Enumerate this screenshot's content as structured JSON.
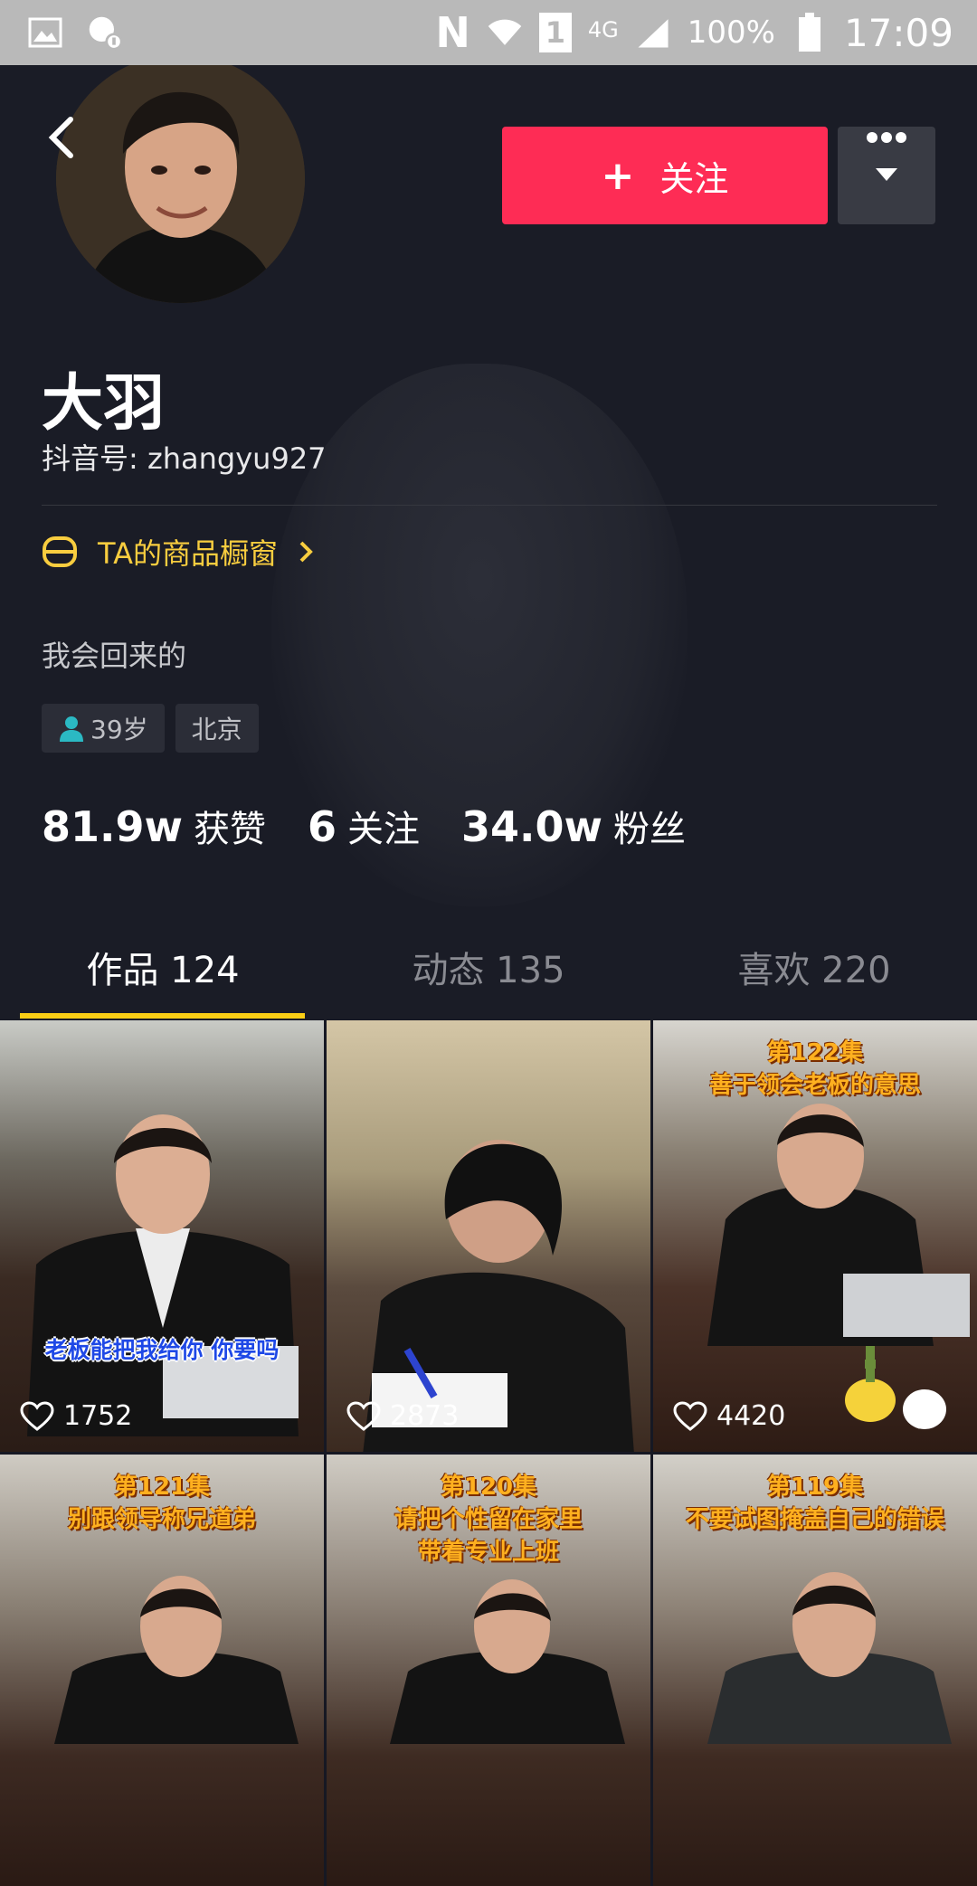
{
  "status_bar": {
    "network_letter": "N",
    "sim_slot": "1",
    "network_type": "4G",
    "battery_percent": "100%",
    "time": "17:09",
    "icons": [
      "image-icon",
      "messenger-icon",
      "nfc-icon",
      "wifi-icon",
      "sim-icon",
      "signal-icon",
      "battery-icon"
    ]
  },
  "profile": {
    "nickname": "大羽",
    "user_id": "抖音号: zhangyu927",
    "shop_label": "TA的商品橱窗",
    "bio": "我会回来的",
    "tags": [
      {
        "label": "39岁",
        "icon": "person-icon"
      },
      {
        "label": "北京"
      }
    ],
    "follow_label": "关注"
  },
  "stats": [
    {
      "value": "81.9w",
      "label": "获赞"
    },
    {
      "value": "6",
      "label": "关注"
    },
    {
      "value": "34.0w",
      "label": "粉丝"
    }
  ],
  "tabs": [
    {
      "label": "作品 124",
      "active": true
    },
    {
      "label": "动态 135",
      "active": false
    },
    {
      "label": "喜欢 220",
      "active": false
    }
  ],
  "videos": [
    {
      "caption": "老板能把我给你 你要吗",
      "likes": "1752"
    },
    {
      "likes": "2873"
    },
    {
      "title_line1": "第122集",
      "title_line2": "善于领会老板的意思",
      "likes": "4420"
    },
    {
      "title_line1": "第121集",
      "title_line2": "别跟领导称兄道弟"
    },
    {
      "title_line1": "第120集",
      "title_line2": "请把个性留在家里",
      "title_line3": "带着专业上班"
    },
    {
      "title_line1": "第119集",
      "title_line2": "不要试图掩盖自己的错误"
    }
  ],
  "colors": {
    "background": "#161823",
    "follow": "#fe2c55",
    "accent_yellow": "#face15",
    "shop_text": "#f8cd3f"
  }
}
